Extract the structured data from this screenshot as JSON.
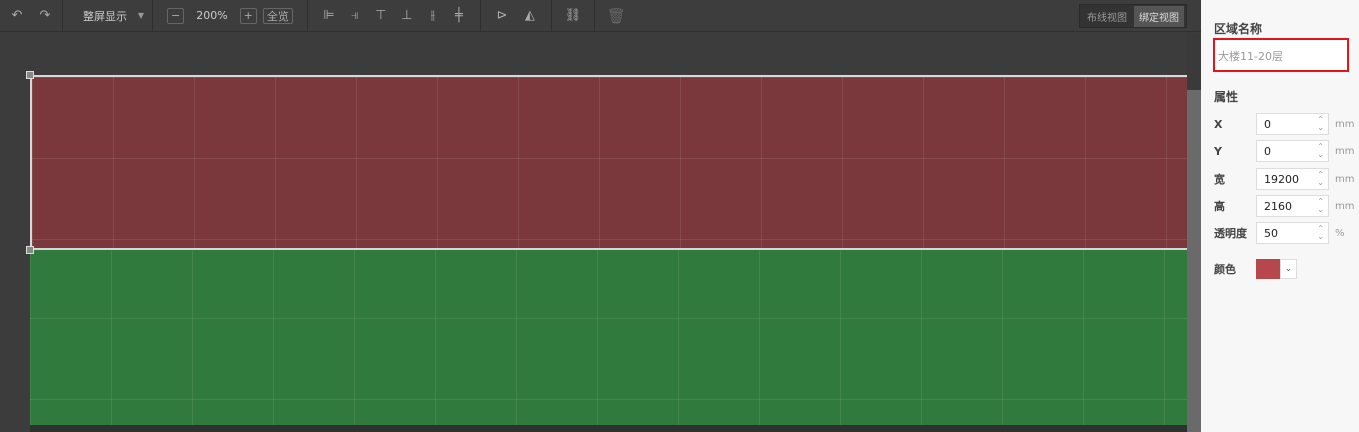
{
  "toolbar": {
    "display_mode": "整屏显示",
    "zoom": "200%",
    "fit_all": "全览"
  },
  "views": {
    "wiring": "布线视图",
    "binding": "绑定视图",
    "active": "绑定视图"
  },
  "panel": {
    "region_name_label": "区域名称",
    "region_name": "大楼11-20层",
    "properties_label": "属性",
    "fields": [
      {
        "label": "X",
        "value": "0",
        "unit": "mm"
      },
      {
        "label": "Y",
        "value": "0",
        "unit": "mm"
      },
      {
        "label": "宽",
        "value": "19200",
        "unit": "mm"
      },
      {
        "label": "高",
        "value": "2160",
        "unit": "mm"
      },
      {
        "label": "透明度",
        "value": "50",
        "unit": "%"
      }
    ],
    "color_label": "颜色",
    "color": "#b6474c"
  },
  "canvas": {
    "region_colors": {
      "selected": "#7a383c",
      "other": "#2f7a3c"
    }
  }
}
